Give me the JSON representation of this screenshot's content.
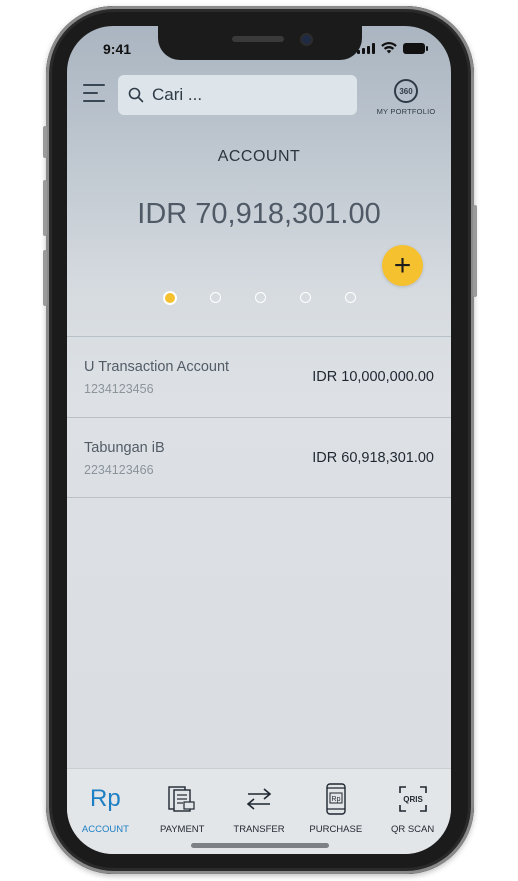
{
  "status_bar": {
    "time": "9:41"
  },
  "header": {
    "search": {
      "value": "",
      "placeholder": "Cari ..."
    },
    "portfolio": {
      "icon_text": "360",
      "label": "MY PORTFOLIO"
    }
  },
  "account": {
    "title": "ACCOUNT",
    "total_balance": "IDR 70,918,301.00",
    "add_label": "+",
    "carousel": {
      "pages": 5,
      "active_index": 0
    }
  },
  "accounts": [
    {
      "name": "U Transaction Account",
      "number": "1234123456",
      "balance": "IDR 10,000,000.00"
    },
    {
      "name": "Tabungan iB",
      "number": "2234123466",
      "balance": "IDR 60,918,301.00"
    }
  ],
  "bottom_nav": [
    {
      "label": "ACCOUNT",
      "icon": "rupiah-icon",
      "icon_text": "Rp",
      "active": true
    },
    {
      "label": "PAYMENT",
      "icon": "bill-icon",
      "active": false
    },
    {
      "label": "TRANSFER",
      "icon": "transfer-arrows-icon",
      "active": false
    },
    {
      "label": "PURCHASE",
      "icon": "phone-rp-icon",
      "icon_text": "Rp",
      "active": false
    },
    {
      "label": "QR SCAN",
      "icon": "qris-icon",
      "icon_text": "QRIS",
      "active": false
    }
  ],
  "colors": {
    "accent_yellow": "#f6c12e",
    "active_blue": "#1d7fc4",
    "text_dark": "#1f2730"
  }
}
